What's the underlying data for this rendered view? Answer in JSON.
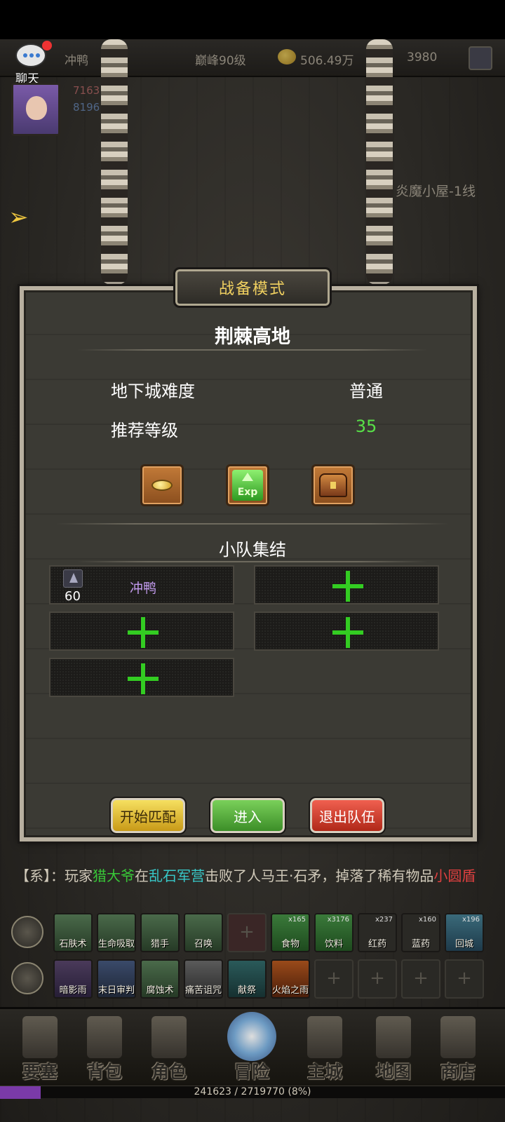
{
  "topbar": {
    "player_name": "冲鸭",
    "level": "巅峰90级",
    "gold": "506.49万",
    "gems": "3980"
  },
  "chat": {
    "label": "聊天"
  },
  "player_stats": {
    "hp": "7163",
    "mp": "8196"
  },
  "map": {
    "name": "炎魔小屋-1线"
  },
  "dialog": {
    "header": "战备模式",
    "dungeon_name": "荆棘高地",
    "difficulty_label": "地下城难度",
    "difficulty_value": "普通",
    "level_label": "推荐等级",
    "level_value": "35",
    "rewards": [
      "gold-coin-icon",
      "exp-icon",
      "treasure-chest-icon"
    ],
    "exp_text": "Exp",
    "squad_title": "小队集结",
    "members": [
      {
        "name": "冲鸭",
        "level": "60"
      }
    ],
    "buttons": {
      "match": "开始匹配",
      "enter": "进入",
      "leave": "退出队伍"
    }
  },
  "system_message": {
    "prefix": "【系】：玩家",
    "player": "猎大爷",
    "at": "在",
    "place": "乱石军营",
    "action": "击败了人马王·石矛，掉落了稀有物品",
    "item": "小圆盾"
  },
  "consumables": [
    {
      "label": "食物",
      "count": "x165"
    },
    {
      "label": "饮料",
      "count": "x3176"
    },
    {
      "label": "红药",
      "count": "x237"
    },
    {
      "label": "蓝药",
      "count": "x160"
    },
    {
      "label": "回城",
      "count": "x196"
    }
  ],
  "skills_row1": [
    "石肤术",
    "生命吸取",
    "猎手",
    "召唤"
  ],
  "skills_row2": [
    "暗影雨",
    "末日审判",
    "腐蚀术",
    "痛苦诅咒",
    "献祭",
    "火焰之雨"
  ],
  "nav": [
    {
      "label": "要塞"
    },
    {
      "label": "背包"
    },
    {
      "label": "角色"
    },
    {
      "label": "冒险"
    },
    {
      "label": "主城"
    },
    {
      "label": "地图"
    },
    {
      "label": "商店"
    }
  ],
  "exp_bar": {
    "text": "241623 / 2719770 (8%)",
    "fraction": 0.08
  },
  "colors": {
    "accent_gold": "#f0d060",
    "green_plus": "#33cc22",
    "member_name": "#c49cf0"
  }
}
